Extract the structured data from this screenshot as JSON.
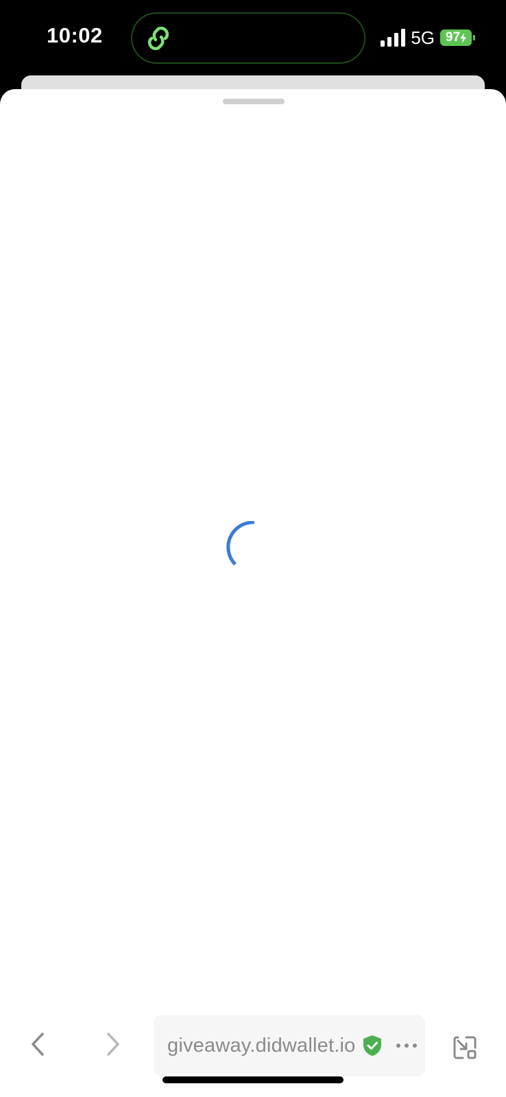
{
  "status_bar": {
    "time": "10:02",
    "network": "5G",
    "battery_percent": "97",
    "battery_charging": true,
    "signal_bars": 4,
    "island_icon": "link-icon",
    "colors": {
      "island_icon": "#7ddf74",
      "battery": "#5ec554"
    }
  },
  "sheet": {
    "loading": true,
    "spinner_color": "#3a7bd5"
  },
  "toolbar": {
    "back_icon": "chevron-left-icon",
    "forward_icon": "chevron-right-icon",
    "url": "giveaway.didwallet.io",
    "verified_icon": "shield-check-icon",
    "verified_color": "#4caf50",
    "more_icon": "ellipsis-icon",
    "minimize_icon": "minimize-window-icon"
  }
}
